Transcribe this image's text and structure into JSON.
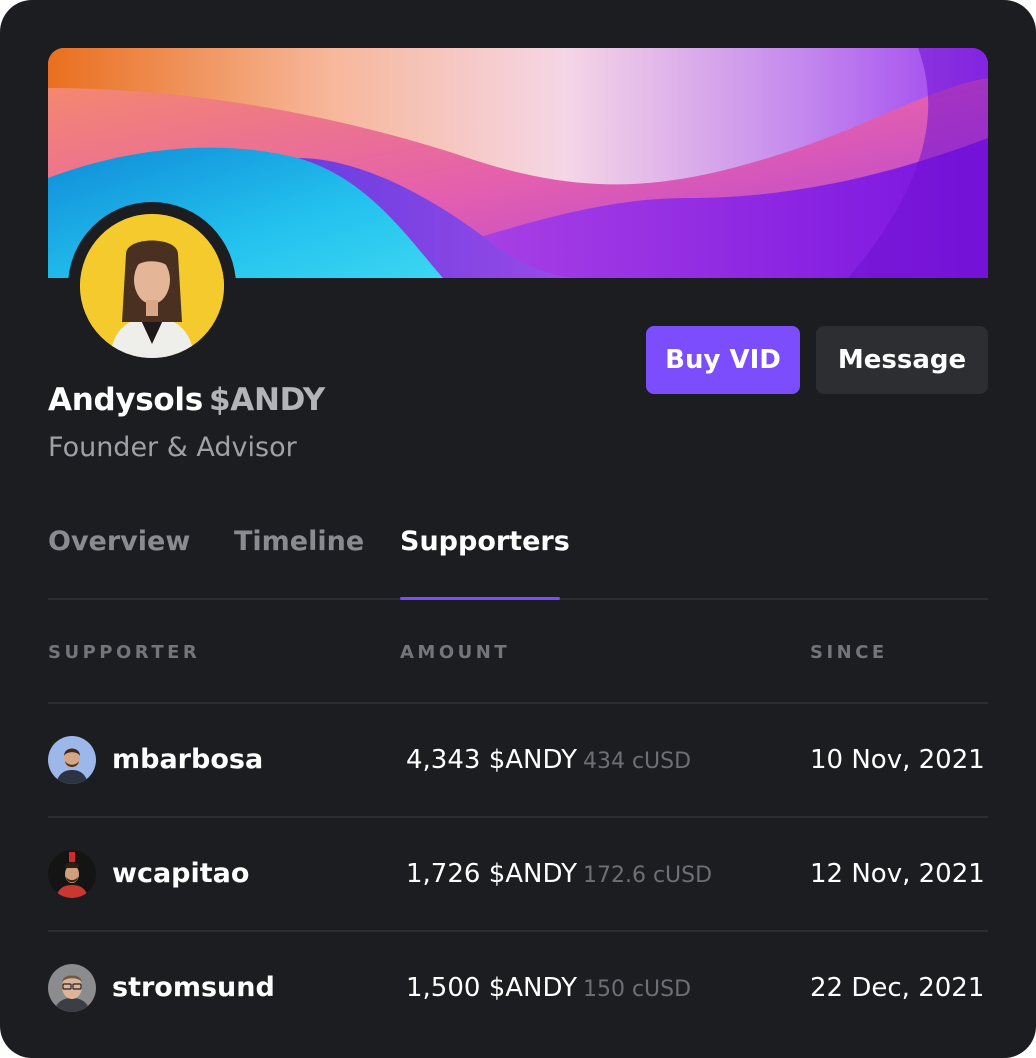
{
  "profile": {
    "name": "Andysols",
    "ticker": "$ANDY",
    "role": "Founder & Advisor"
  },
  "actions": {
    "buy_label": "Buy VID",
    "message_label": "Message"
  },
  "tabs": [
    {
      "label": "Overview",
      "active": false
    },
    {
      "label": "Timeline",
      "active": false
    },
    {
      "label": "Supporters",
      "active": true
    }
  ],
  "table": {
    "headers": {
      "supporter": "SUPPORTER",
      "amount": "AMOUNT",
      "since": "SINCE"
    },
    "rows": [
      {
        "supporter": "mbarbosa",
        "amount": "4,343 $ANDY",
        "amount_usd": "434 cUSD",
        "since": "10 Nov, 2021"
      },
      {
        "supporter": "wcapitao",
        "amount": "1,726 $ANDY",
        "amount_usd": "172.6 cUSD",
        "since": "12 Nov, 2021"
      },
      {
        "supporter": "stromsund",
        "amount": "1,500 $ANDY",
        "amount_usd": "150 cUSD",
        "since": "22 Dec, 2021"
      }
    ]
  },
  "colors": {
    "background": "#1c1d20",
    "accent": "#7b4dfc",
    "secondary_button": "#2d2e32",
    "muted_text": "#8a8a90"
  }
}
